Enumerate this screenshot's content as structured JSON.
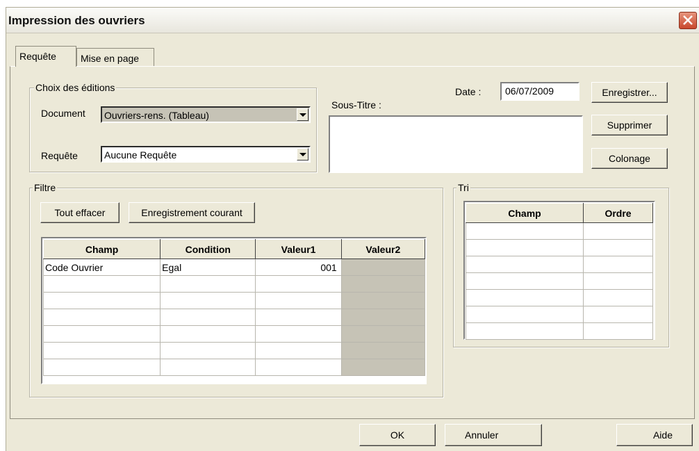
{
  "window": {
    "title": "Impression des ouvriers"
  },
  "tabs": [
    {
      "label": "Requête",
      "active": true
    },
    {
      "label": "Mise en page",
      "active": false
    }
  ],
  "editions": {
    "group_label": "Choix des éditions",
    "document_label": "Document",
    "document_value": "Ouvriers-rens. (Tableau)",
    "requete_label": "Requête",
    "requete_value": "Aucune Requête"
  },
  "soustitre": {
    "label": "Sous-Titre :",
    "value": ""
  },
  "date": {
    "label": "Date :",
    "value": "06/07/2009"
  },
  "side_buttons": {
    "enregistrer": "Enregistrer...",
    "supprimer": "Supprimer",
    "colonage": "Colonage"
  },
  "filtre": {
    "group_label": "Filtre",
    "tout_effacer": "Tout effacer",
    "enregistrement_courant": "Enregistrement courant",
    "columns": [
      "Champ",
      "Condition",
      "Valeur1",
      "Valeur2"
    ],
    "rows": [
      {
        "champ": "Code Ouvrier",
        "condition": "Egal",
        "valeur1": "001",
        "valeur2": ""
      }
    ]
  },
  "tri": {
    "group_label": "Tri",
    "columns": [
      "Champ",
      "Ordre"
    ]
  },
  "footer": {
    "ok": "OK",
    "annuler": "Annuler",
    "aide": "Aide"
  },
  "colors": {
    "window_bg": "#ece9d8",
    "disabled_cell": "#c6c3b6",
    "close_button": "#c9472c"
  }
}
